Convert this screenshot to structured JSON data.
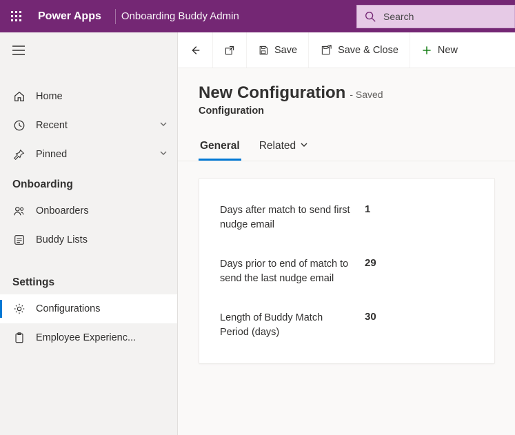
{
  "header": {
    "brand": "Power Apps",
    "app_name": "Onboarding Buddy Admin",
    "search_placeholder": "Search"
  },
  "sidebar": {
    "items": [
      {
        "label": "Home"
      },
      {
        "label": "Recent"
      },
      {
        "label": "Pinned"
      }
    ],
    "group_onboarding": "Onboarding",
    "onboarding": [
      {
        "label": "Onboarders"
      },
      {
        "label": "Buddy Lists"
      }
    ],
    "group_settings": "Settings",
    "settings": [
      {
        "label": "Configurations"
      },
      {
        "label": "Employee Experienc..."
      }
    ]
  },
  "commands": {
    "save": "Save",
    "save_close": "Save & Close",
    "new": "New"
  },
  "page": {
    "title": "New Configuration",
    "status": "- Saved",
    "entity": "Configuration"
  },
  "tabs": {
    "general": "General",
    "related": "Related"
  },
  "fields": [
    {
      "label": "Days after match to send first nudge email",
      "value": "1"
    },
    {
      "label": "Days prior to end of match to send the last nudge email",
      "value": "29"
    },
    {
      "label": "Length of Buddy Match Period (days)",
      "value": "30"
    }
  ]
}
